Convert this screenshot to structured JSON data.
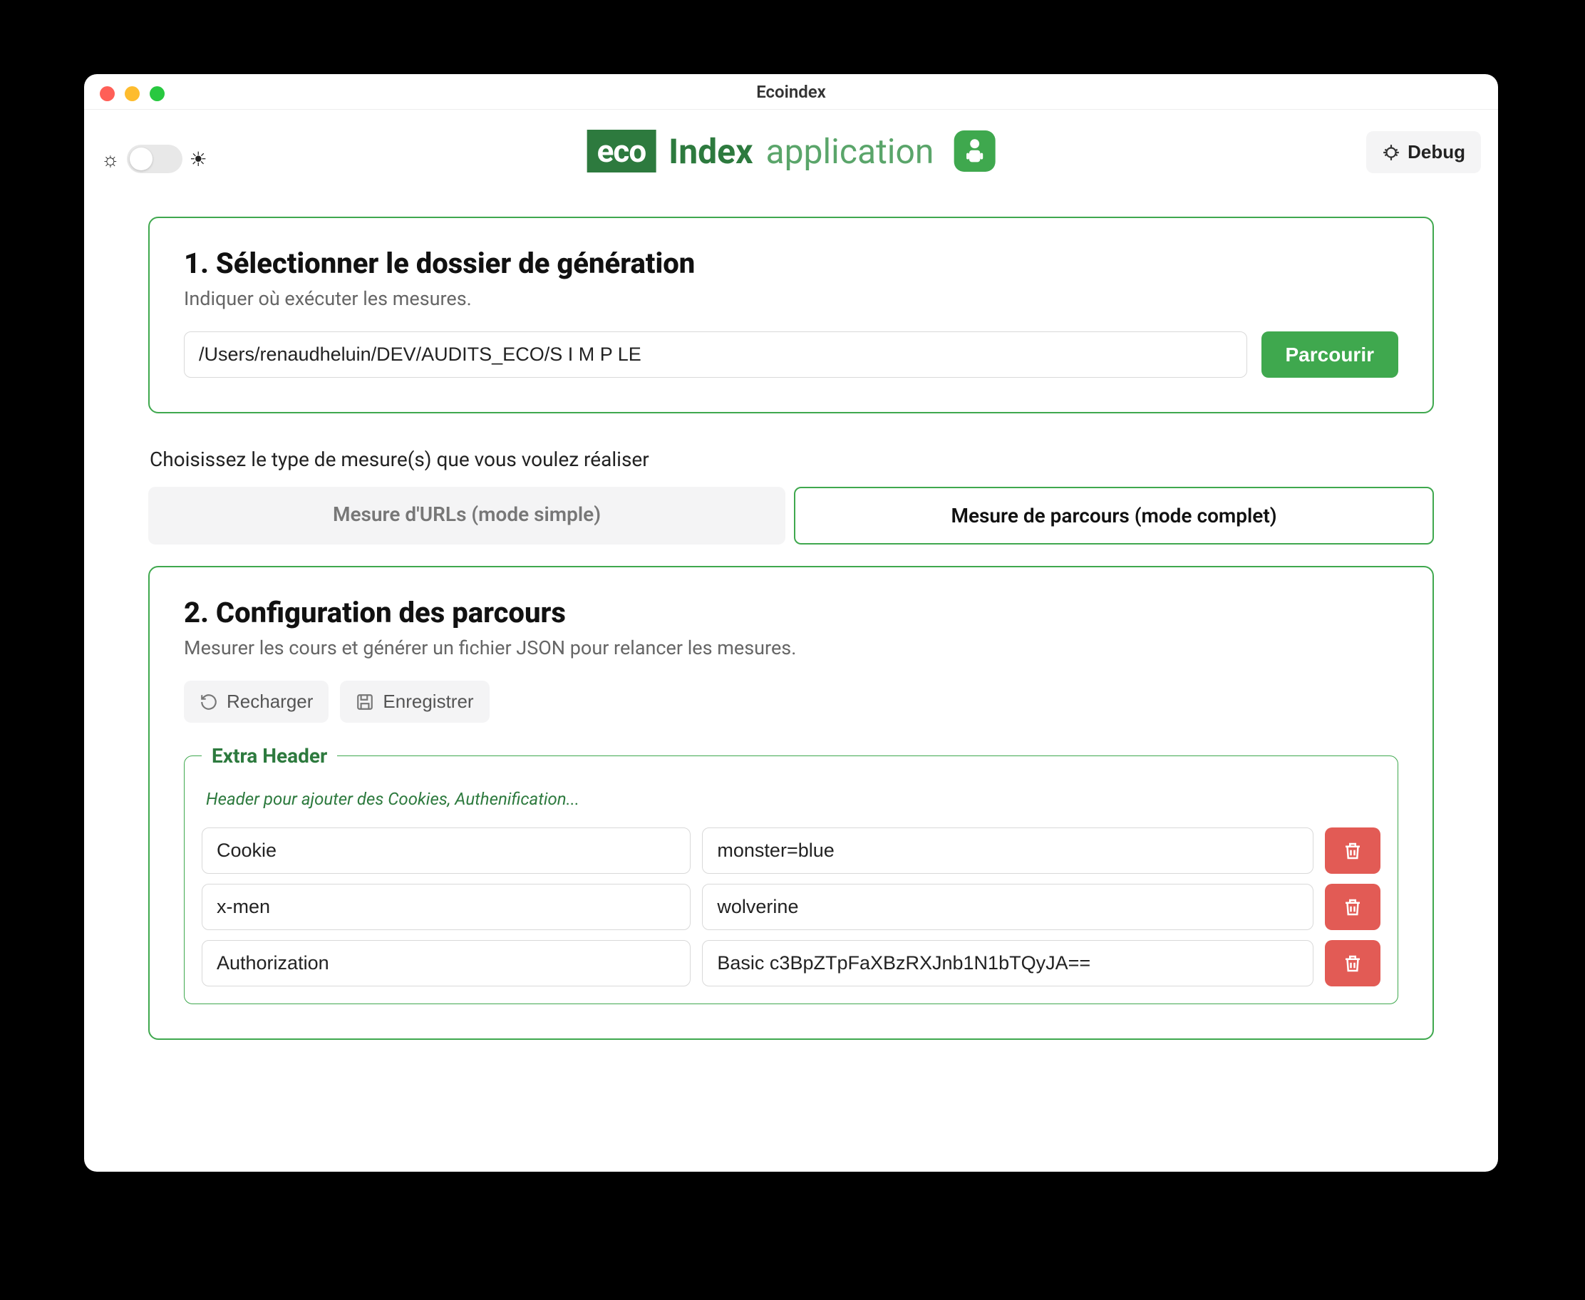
{
  "window": {
    "title": "Ecoindex"
  },
  "header": {
    "debug_label": "Debug",
    "logo_eco": "eco",
    "logo_index": "Index",
    "logo_app": "application"
  },
  "step1": {
    "title": "1. Sélectionner le dossier de génération",
    "subtitle": "Indiquer où exécuter les mesures.",
    "path_value": "/Users/renaudheluin/DEV/AUDITS_ECO/S I M P LE",
    "browse_label": "Parcourir"
  },
  "measure": {
    "prompt": "Choisissez le type de mesure(s) que vous voulez réaliser",
    "tab_simple": "Mesure d'URLs (mode simple)",
    "tab_full": "Mesure de parcours (mode complet)"
  },
  "step2": {
    "title": "2. Configuration des parcours",
    "subtitle": "Mesurer les cours et générer un fichier JSON pour relancer les mesures.",
    "reload_label": "Recharger",
    "save_label": "Enregistrer",
    "extra_header_legend": "Extra Header",
    "extra_header_hint": "Header pour ajouter des Cookies, Authenification...",
    "headers": [
      {
        "key": "Cookie",
        "value": "monster=blue"
      },
      {
        "key": "x-men",
        "value": "wolverine"
      },
      {
        "key": "Authorization",
        "value": "Basic c3BpZTpFaXBzRXJnb1N1bTQyJA=="
      }
    ]
  }
}
